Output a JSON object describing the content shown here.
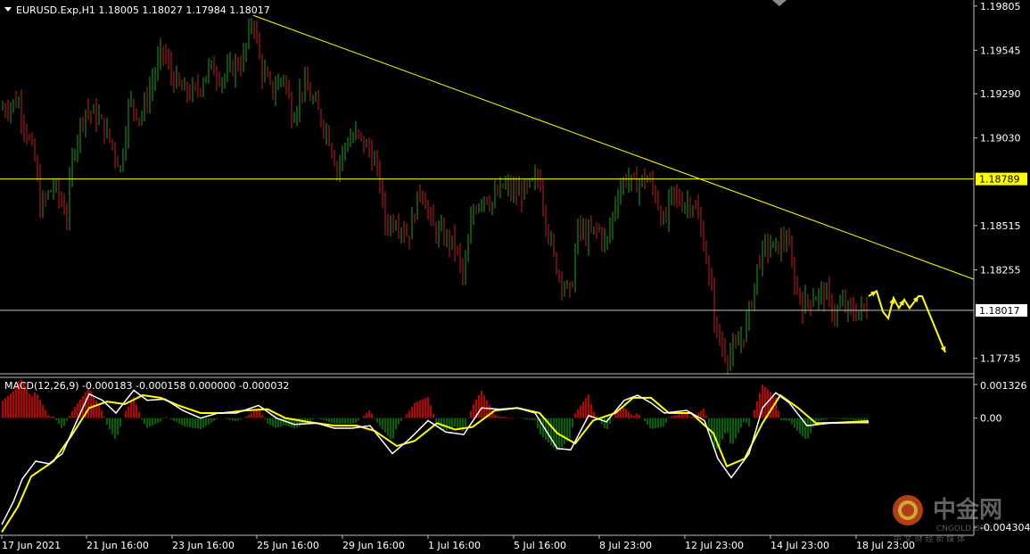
{
  "chart_data": [
    {
      "type": "candlestick",
      "title": "EURUSD.Exp,H1  1.18005 1.18027 1.17984 1.18017",
      "symbol": "EURUSD.Exp",
      "timeframe": "H1",
      "ohlc_header": {
        "open": "1.18005",
        "high": "1.18027",
        "low": "1.17984",
        "close": "1.18017"
      },
      "ylim": [
        1.1766,
        1.1983
      ],
      "y_ticks": [
        "1.19805",
        "1.19545",
        "1.19290",
        "1.19030",
        "1.18515",
        "1.18255",
        "1.17735"
      ],
      "x_ticks": [
        "17 Jun 2021",
        "21 Jun 16:00",
        "23 Jun 16:00",
        "25 Jun 16:00",
        "29 Jun 16:00",
        "1 Jul 16:00",
        "5 Jul 16:00",
        "8 Jul 23:00",
        "12 Jul 23:00",
        "14 Jul 23:00",
        "18 Jul 23:00"
      ],
      "horizontal_lines": [
        {
          "price": 1.18789,
          "label": "1.18789",
          "color": "#ffff00",
          "highlighted": true
        },
        {
          "price": 1.18017,
          "label": "1.18017",
          "color": "#c0c0c0",
          "highlighted": false
        }
      ],
      "trendline": {
        "from": {
          "bar": 284,
          "price": 1.1975
        },
        "to": {
          "bar": 1092,
          "price": 1.182
        },
        "color": "#ffff00"
      },
      "projection_arrows": [
        [
          974,
          1.181
        ],
        [
          983,
          1.1813
        ],
        [
          990,
          1.1801
        ],
        [
          996,
          1.1797
        ],
        [
          1002,
          1.1809
        ],
        [
          1008,
          1.1803
        ],
        [
          1014,
          1.1808
        ],
        [
          1020,
          1.1803
        ],
        [
          1030,
          1.181
        ],
        [
          1034,
          1.181
        ],
        [
          1060,
          1.1777
        ]
      ],
      "series": [
        {
          "name": "price_path",
          "values": [
            [
              2,
              1.192
            ],
            [
              20,
              1.1925
            ],
            [
              40,
              1.1888
            ],
            [
              45,
              1.1862
            ],
            [
              60,
              1.1875
            ],
            [
              75,
              1.1858
            ],
            [
              82,
              1.1895
            ],
            [
              95,
              1.192
            ],
            [
              110,
              1.1915
            ],
            [
              125,
              1.19
            ],
            [
              135,
              1.1885
            ],
            [
              145,
              1.1925
            ],
            [
              158,
              1.1915
            ],
            [
              170,
              1.1935
            ],
            [
              182,
              1.1955
            ],
            [
              192,
              1.194
            ],
            [
              205,
              1.193
            ],
            [
              220,
              1.193
            ],
            [
              235,
              1.1945
            ],
            [
              250,
              1.1938
            ],
            [
              262,
              1.1945
            ],
            [
              272,
              1.1948
            ],
            [
              284,
              1.1975
            ],
            [
              292,
              1.1945
            ],
            [
              305,
              1.193
            ],
            [
              318,
              1.194
            ],
            [
              328,
              1.1915
            ],
            [
              340,
              1.1935
            ],
            [
              355,
              1.192
            ],
            [
              368,
              1.1905
            ],
            [
              378,
              1.1885
            ],
            [
              388,
              1.19
            ],
            [
              400,
              1.1905
            ],
            [
              415,
              1.1895
            ],
            [
              425,
              1.188
            ],
            [
              432,
              1.1853
            ],
            [
              445,
              1.1855
            ],
            [
              458,
              1.1845
            ],
            [
              472,
              1.1875
            ],
            [
              485,
              1.185
            ],
            [
              498,
              1.1845
            ],
            [
              510,
              1.184
            ],
            [
              520,
              1.182
            ],
            [
              530,
              1.186
            ],
            [
              542,
              1.187
            ],
            [
              552,
              1.1865
            ],
            [
              565,
              1.1875
            ],
            [
              578,
              1.187
            ],
            [
              590,
              1.1872
            ],
            [
              605,
              1.188
            ],
            [
              612,
              1.1855
            ],
            [
              622,
              1.183
            ],
            [
              630,
              1.182
            ],
            [
              640,
              1.181
            ],
            [
              648,
              1.185
            ],
            [
              658,
              1.1845
            ],
            [
              670,
              1.185
            ],
            [
              680,
              1.184
            ],
            [
              692,
              1.187
            ],
            [
              702,
              1.188
            ],
            [
              712,
              1.1875
            ],
            [
              725,
              1.188
            ],
            [
              735,
              1.187
            ],
            [
              745,
              1.185
            ],
            [
              752,
              1.187
            ],
            [
              765,
              1.1865
            ],
            [
              778,
              1.1865
            ],
            [
              790,
              1.184
            ],
            [
              798,
              1.181
            ],
            [
              805,
              1.1785
            ],
            [
              815,
              1.1775
            ],
            [
              825,
              1.1778
            ],
            [
              835,
              1.179
            ],
            [
              842,
              1.1805
            ],
            [
              850,
              1.183
            ],
            [
              860,
              1.184
            ],
            [
              870,
              1.1838
            ],
            [
              882,
              1.1845
            ],
            [
              890,
              1.182
            ],
            [
              900,
              1.1805
            ],
            [
              912,
              1.181
            ],
            [
              925,
              1.1812
            ],
            [
              935,
              1.18
            ],
            [
              945,
              1.1805
            ],
            [
              955,
              1.18
            ],
            [
              965,
              1.1802
            ],
            [
              974,
              1.1802
            ]
          ]
        }
      ]
    },
    {
      "type": "line",
      "title": "MACD(12,26,9) -0.000183 -0.000158 0.000000 -0.000032",
      "indicator": "MACD(12,26,9)",
      "values_header": [
        "-0.000183",
        "-0.000158",
        "0.000000",
        "-0.000032"
      ],
      "ylim": [
        -0.00455,
        0.0015
      ],
      "y_ticks": [
        "0.001326",
        "0.00",
        "-0.004304"
      ],
      "series": [
        {
          "name": "macd",
          "color": "#ffffff",
          "values": [
            [
              2,
              -0.0042
            ],
            [
              15,
              -0.0033
            ],
            [
              25,
              -0.0024
            ],
            [
              40,
              -0.0017
            ],
            [
              55,
              -0.0018
            ],
            [
              70,
              -0.0014
            ],
            [
              85,
              -0.0002
            ],
            [
              100,
              0.00095
            ],
            [
              115,
              0.0007
            ],
            [
              130,
              0.0002
            ],
            [
              150,
              0.0011
            ],
            [
              165,
              0.0007
            ],
            [
              185,
              0.00075
            ],
            [
              205,
              0.0003
            ],
            [
              225,
              0.0
            ],
            [
              245,
              0.0002
            ],
            [
              265,
              0.0002
            ],
            [
              290,
              0.0005
            ],
            [
              310,
              0.0
            ],
            [
              330,
              -0.00025
            ],
            [
              355,
              -0.0002
            ],
            [
              375,
              -0.0004
            ],
            [
              395,
              -0.0004
            ],
            [
              415,
              -0.0003
            ],
            [
              440,
              -0.0014
            ],
            [
              460,
              -0.0008
            ],
            [
              480,
              -0.0001
            ],
            [
              500,
              -0.00055
            ],
            [
              520,
              -0.00065
            ],
            [
              540,
              0.0004
            ],
            [
              560,
              0.00035
            ],
            [
              580,
              0.0004
            ],
            [
              600,
              0.0002
            ],
            [
              625,
              -0.0012
            ],
            [
              640,
              -0.00125
            ],
            [
              660,
              0.0001
            ],
            [
              680,
              -0.00015
            ],
            [
              700,
              0.0007
            ],
            [
              715,
              0.0009
            ],
            [
              730,
              0.0006
            ],
            [
              745,
              0.0002
            ],
            [
              770,
              0.0003
            ],
            [
              790,
              -0.0001
            ],
            [
              805,
              -0.0016
            ],
            [
              820,
              -0.00235
            ],
            [
              840,
              -0.0014
            ],
            [
              855,
              0.0004
            ],
            [
              870,
              0.001
            ],
            [
              885,
              0.0006
            ],
            [
              905,
              -0.0003
            ],
            [
              930,
              -0.0002
            ],
            [
              960,
              -0.00018
            ],
            [
              974,
              -0.00018
            ]
          ]
        },
        {
          "name": "signal",
          "color": "#ffff00",
          "values": [
            [
              2,
              -0.0045
            ],
            [
              20,
              -0.0035
            ],
            [
              35,
              -0.0023
            ],
            [
              60,
              -0.0017
            ],
            [
              80,
              -0.0007
            ],
            [
              100,
              0.0004
            ],
            [
              120,
              0.00065
            ],
            [
              140,
              0.00055
            ],
            [
              160,
              0.0009
            ],
            [
              180,
              0.0008
            ],
            [
              200,
              0.0005
            ],
            [
              225,
              0.0002
            ],
            [
              250,
              0.0002
            ],
            [
              275,
              0.0003
            ],
            [
              300,
              0.00035
            ],
            [
              320,
              0.0
            ],
            [
              345,
              -0.00015
            ],
            [
              375,
              -0.0003
            ],
            [
              400,
              -0.0003
            ],
            [
              420,
              -0.0005
            ],
            [
              445,
              -0.0011
            ],
            [
              465,
              -0.0009
            ],
            [
              490,
              -0.0002
            ],
            [
              510,
              -0.00045
            ],
            [
              530,
              -0.00035
            ],
            [
              555,
              0.0003
            ],
            [
              580,
              0.0004
            ],
            [
              605,
              0.0002
            ],
            [
              625,
              -0.0006
            ],
            [
              645,
              -0.001
            ],
            [
              665,
              -0.0001
            ],
            [
              690,
              0.0002
            ],
            [
              710,
              0.0008
            ],
            [
              730,
              0.0008
            ],
            [
              750,
              0.0002
            ],
            [
              775,
              0.0002
            ],
            [
              800,
              -0.0006
            ],
            [
              815,
              -0.0019
            ],
            [
              835,
              -0.0016
            ],
            [
              855,
              -0.0002
            ],
            [
              875,
              0.0009
            ],
            [
              895,
              0.0004
            ],
            [
              915,
              -0.0002
            ],
            [
              940,
              -0.00018
            ],
            [
              974,
              -0.00012
            ]
          ]
        }
      ],
      "histogram": {
        "colors": {
          "up": "#c00000",
          "down": "#006400"
        }
      }
    }
  ],
  "watermark": {
    "cn": "中金网",
    "en": "CNGOLD.ORG",
    "sub": "中 文 财 经 新 媒 体"
  },
  "colors": {
    "background": "#000000",
    "bull": "#1f9e1f",
    "bear": "#c81e1e",
    "trend": "#ffff00",
    "grid": "#c0c0c0"
  }
}
